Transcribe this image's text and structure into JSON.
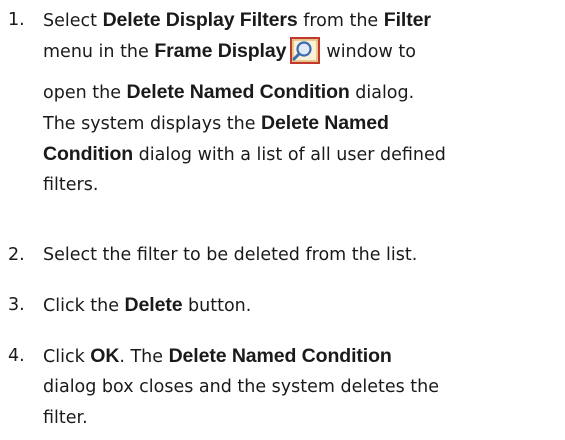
{
  "steps": [
    {
      "number": "1.",
      "lines": [
        [
          {
            "t": "Select "
          },
          {
            "t": "Delete Display Filters",
            "b": true
          },
          {
            "t": " from the "
          },
          {
            "t": "Filter",
            "b": true
          }
        ],
        [
          {
            "t": "menu in the "
          },
          {
            "t": "Frame Display",
            "b": true
          },
          {
            "icon": "frame-display-icon"
          },
          {
            "t": "window to"
          }
        ],
        [
          {
            "t": "open the "
          },
          {
            "t": "Delete Named Condition",
            "b": true
          },
          {
            "t": " dialog."
          }
        ],
        [
          {
            "t": "The system displays the "
          },
          {
            "t": "Delete Named",
            "b": true
          }
        ],
        [
          {
            "t": "Condition",
            "b": true
          },
          {
            "t": " dialog with a list of all user defined"
          }
        ],
        [
          {
            "t": "filters."
          }
        ]
      ]
    },
    {
      "number": "2.",
      "lines": [
        [
          {
            "t": "Select the filter to be deleted from the list."
          }
        ]
      ]
    },
    {
      "number": "3.",
      "lines": [
        [
          {
            "t": "Click the "
          },
          {
            "t": "Delete",
            "b": true
          },
          {
            "t": " button."
          }
        ]
      ]
    },
    {
      "number": "4.",
      "lines": [
        [
          {
            "t": "Click "
          },
          {
            "t": "OK",
            "b": true
          },
          {
            "t": ". The "
          },
          {
            "t": "Delete Named Condition",
            "b": true
          }
        ],
        [
          {
            "t": "dialog box closes and the system deletes the"
          }
        ],
        [
          {
            "t": "filter."
          }
        ]
      ]
    }
  ],
  "colors": {
    "text": "#1a1a1a",
    "icon_frame": "#c0392b",
    "icon_bg": "#f3e3b5",
    "icon_lens": "#3b6bb0"
  }
}
